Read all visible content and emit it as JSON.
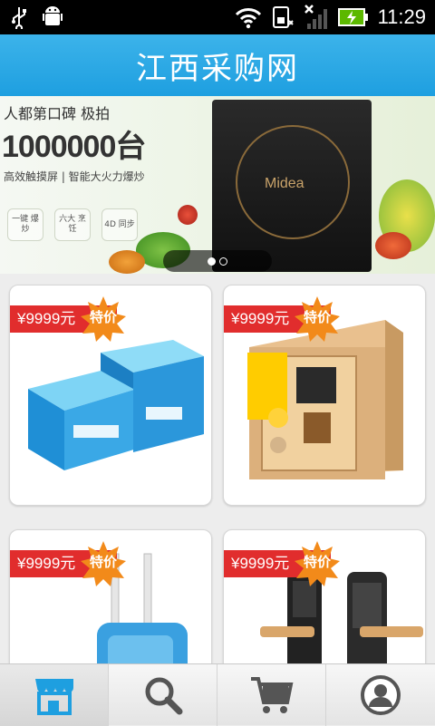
{
  "status_bar": {
    "time": "11:29",
    "icons": [
      "usb-icon",
      "android-debug-icon",
      "wifi-icon",
      "sd-card-icon",
      "no-signal-icon",
      "battery-charging-icon"
    ]
  },
  "app_bar": {
    "title": "江西采购网"
  },
  "banner": {
    "headline_top": "人都第口碑 极拍",
    "headline_number": "1000000台",
    "tagline": "高效触摸屏 | 智能大火力爆炒",
    "features": [
      "一键 爆炒",
      "六大 烹饪",
      "4D 同步"
    ],
    "brand": "Midea",
    "pager": {
      "count": 2,
      "active": 0
    }
  },
  "products": [
    {
      "price": "¥9999元",
      "badge": "特价",
      "image": "paper-box-stack"
    },
    {
      "price": "¥9999元",
      "badge": "特价",
      "image": "electronic-safe"
    },
    {
      "price": "¥9999元",
      "badge": "特价",
      "image": "blue-trolley-device"
    },
    {
      "price": "¥9999元",
      "badge": "特价",
      "image": "smart-door-lock"
    }
  ],
  "tab_bar": {
    "tabs": [
      {
        "name": "home",
        "icon": "store-icon",
        "active": true
      },
      {
        "name": "search",
        "icon": "search-icon",
        "active": false
      },
      {
        "name": "cart",
        "icon": "cart-icon",
        "active": false
      },
      {
        "name": "profile",
        "icon": "user-icon",
        "active": false
      }
    ]
  },
  "colors": {
    "accent": "#1e9fe0",
    "price_red": "#e12d2d",
    "badge_orange": "#f28a1a"
  }
}
